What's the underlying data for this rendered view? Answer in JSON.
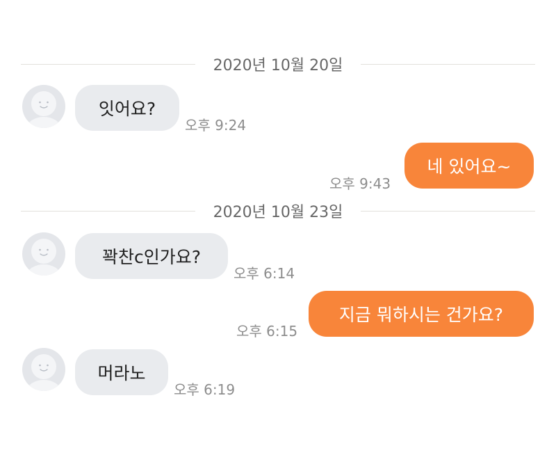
{
  "colors": {
    "incoming_bubble": "#e9ebee",
    "outgoing_bubble": "#f8853a",
    "outgoing_text": "#ffffff",
    "timestamp": "#8c8c8c",
    "separator_line": "#e2e0db"
  },
  "dates": [
    {
      "label": "2020년 10월 20일"
    },
    {
      "label": "2020년 10월 23일"
    }
  ],
  "messages": [
    {
      "direction": "incoming",
      "text": "잇어요?",
      "time": "오후 9:24",
      "avatar_icon": "default-profile-icon"
    },
    {
      "direction": "outgoing",
      "text": "네 있어요~",
      "time": "오후 9:43"
    },
    {
      "direction": "incoming",
      "text": "꽉찬c인가요?",
      "time": "오후 6:14",
      "avatar_icon": "default-profile-icon"
    },
    {
      "direction": "outgoing",
      "text": "지금 뭐하시는 건가요?",
      "time": "오후 6:15"
    },
    {
      "direction": "incoming",
      "text": "머라노",
      "time": "오후 6:19",
      "avatar_icon": "default-profile-icon"
    }
  ]
}
